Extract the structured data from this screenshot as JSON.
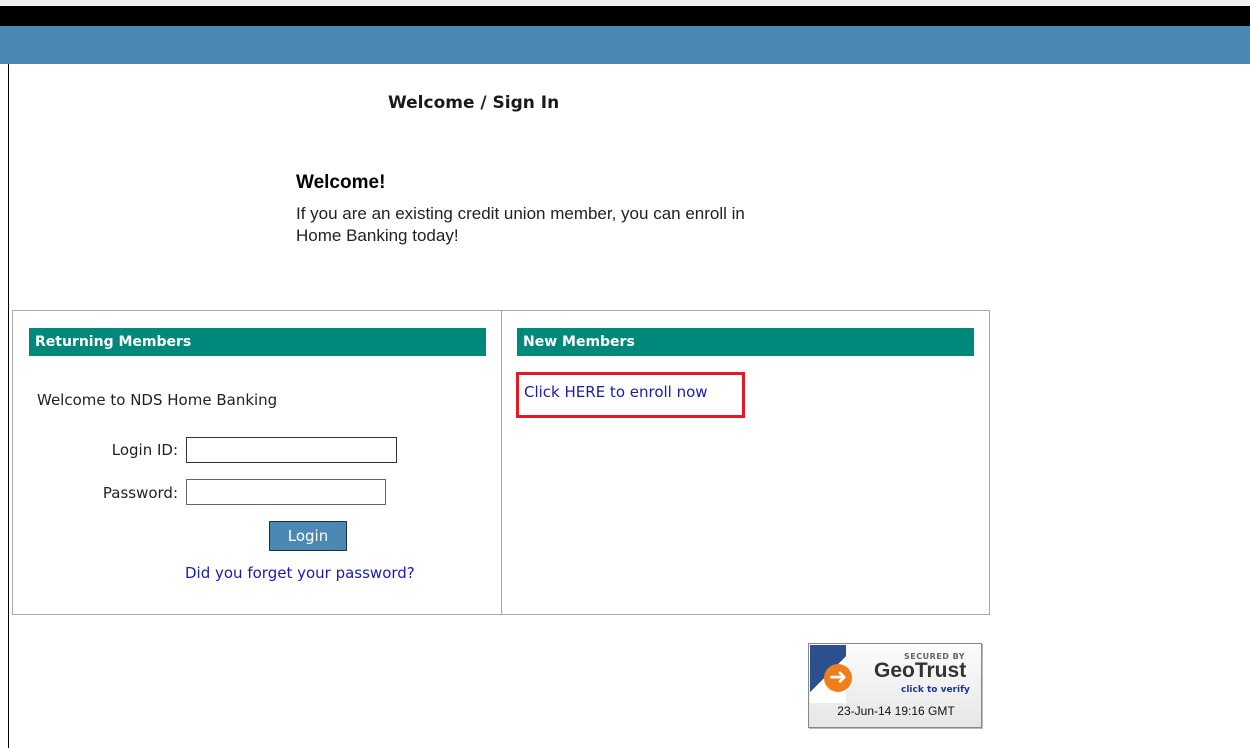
{
  "page": {
    "title": "Welcome / Sign In"
  },
  "intro": {
    "heading": "Welcome!",
    "text": "If you are an existing credit union member, you can enroll in Home Banking today!"
  },
  "returning": {
    "header": "Returning Members",
    "welcome": "Welcome to NDS Home Banking",
    "login_label": "Login ID:",
    "login_value": "",
    "password_label": "Password:",
    "password_value": "",
    "login_button": "Login",
    "forgot_link": "Did you forget your password?"
  },
  "new_members": {
    "header": "New Members",
    "enroll_link": "Click HERE to enroll now"
  },
  "seal": {
    "secured_by": "SECURED BY",
    "brand_prefix": "Geo",
    "brand_suffix": "Trust",
    "verify": "click to verify",
    "timestamp": "23-Jun-14 19:16 GMT",
    "logo_icon": "geotrust-logo-icon"
  },
  "colors": {
    "top_bar": "#000000",
    "banner": "#4b89b4",
    "section_header": "#00897b",
    "link": "#1b1bb0",
    "highlight": "#e01b24"
  }
}
